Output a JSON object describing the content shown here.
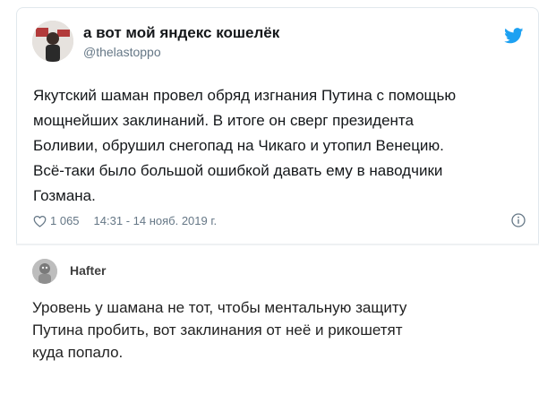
{
  "tweet": {
    "author_name": "а вот мой яндекс кошелёк",
    "handle": "@thelastoppo",
    "lines": [
      "Якутский шаман провел обряд изгнания Путина с помощью",
      "мощнейших заклинаний. В итоге он сверг президента",
      "Боливии, обрушил снегопад на Чикаго и утопил Венецию.",
      "Всё-таки было большой ошибкой давать ему в наводчики",
      "Гозмана."
    ],
    "likes": "1 065",
    "timestamp": "14:31 - 14 нояб. 2019 г.",
    "icons": {
      "platform": "twitter-bird-icon",
      "like": "heart-icon",
      "info": "info-icon"
    },
    "accent_color": "#1da1f2"
  },
  "reply": {
    "author_name": "Hafter",
    "lines": [
      "Уровень у шамана не тот, чтобы ментальную защиту",
      "Путина пробить, вот заклинания от неё и рикошетят",
      "куда попало."
    ]
  }
}
